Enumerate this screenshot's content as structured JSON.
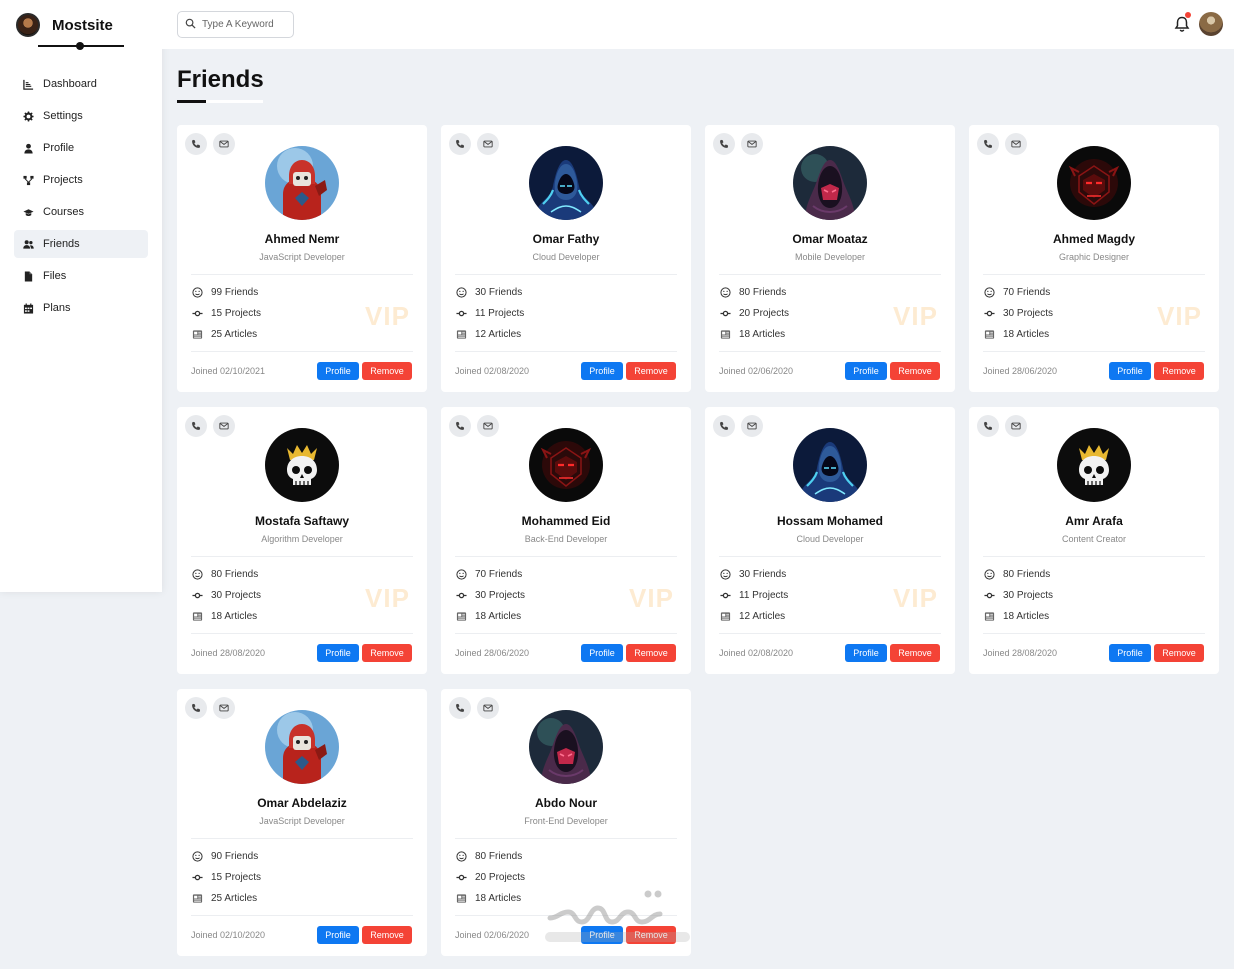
{
  "brand": {
    "name": "Mostsite"
  },
  "nav": [
    {
      "label": "Dashboard",
      "icon": "chart-icon",
      "active": false
    },
    {
      "label": "Settings",
      "icon": "gear-icon",
      "active": false
    },
    {
      "label": "Profile",
      "icon": "user-icon",
      "active": false
    },
    {
      "label": "Projects",
      "icon": "diagram-icon",
      "active": false
    },
    {
      "label": "Courses",
      "icon": "graduation-cap-icon",
      "active": false
    },
    {
      "label": "Friends",
      "icon": "users-icon",
      "active": true
    },
    {
      "label": "Files",
      "icon": "file-icon",
      "active": false
    },
    {
      "label": "Plans",
      "icon": "calendar-icon",
      "active": false
    }
  ],
  "search": {
    "placeholder": "Type A Keyword",
    "value": ""
  },
  "page": {
    "title": "Friends"
  },
  "buttons": {
    "profile": "Profile",
    "remove": "Remove"
  },
  "vip_label": "VIP",
  "friends": [
    {
      "name": "Ahmed Nemr",
      "role": "JavaScript Developer",
      "friends": "99 Friends",
      "projects": "15 Projects",
      "articles": "25 Articles",
      "joined": "Joined 02/10/2021",
      "vip": true,
      "avatar": "red-knight"
    },
    {
      "name": "Omar Fathy",
      "role": "Cloud Developer",
      "friends": "30 Friends",
      "projects": "11 Projects",
      "articles": "12 Articles",
      "joined": "Joined 02/08/2020",
      "vip": false,
      "avatar": "blue-hood"
    },
    {
      "name": "Omar Moataz",
      "role": "Mobile Developer",
      "friends": "80 Friends",
      "projects": "20 Projects",
      "articles": "18 Articles",
      "joined": "Joined 02/06/2020",
      "vip": true,
      "avatar": "pink-hood"
    },
    {
      "name": "Ahmed Magdy",
      "role": "Graphic Designer",
      "friends": "70 Friends",
      "projects": "30 Projects",
      "articles": "18 Articles",
      "joined": "Joined 28/06/2020",
      "vip": true,
      "avatar": "red-robot"
    },
    {
      "name": "Mostafa Saftawy",
      "role": "Algorithm Developer",
      "friends": "80 Friends",
      "projects": "30 Projects",
      "articles": "18 Articles",
      "joined": "Joined 28/08/2020",
      "vip": true,
      "avatar": "skull-crown"
    },
    {
      "name": "Mohammed Eid",
      "role": "Back-End Developer",
      "friends": "70 Friends",
      "projects": "30 Projects",
      "articles": "18 Articles",
      "joined": "Joined 28/06/2020",
      "vip": true,
      "avatar": "red-robot"
    },
    {
      "name": "Hossam Mohamed",
      "role": "Cloud Developer",
      "friends": "30 Friends",
      "projects": "11 Projects",
      "articles": "12 Articles",
      "joined": "Joined 02/08/2020",
      "vip": true,
      "avatar": "blue-hood"
    },
    {
      "name": "Amr Arafa",
      "role": "Content Creator",
      "friends": "80 Friends",
      "projects": "30 Projects",
      "articles": "18 Articles",
      "joined": "Joined 28/08/2020",
      "vip": false,
      "avatar": "skull-crown"
    },
    {
      "name": "Omar Abdelaziz",
      "role": "JavaScript Developer",
      "friends": "90 Friends",
      "projects": "15 Projects",
      "articles": "25 Articles",
      "joined": "Joined 02/10/2020",
      "vip": false,
      "avatar": "red-knight"
    },
    {
      "name": "Abdo Nour",
      "role": "Front-End Developer",
      "friends": "80 Friends",
      "projects": "20 Projects",
      "articles": "18 Articles",
      "joined": "Joined 02/06/2020",
      "vip": false,
      "avatar": "pink-hood"
    }
  ],
  "colors": {
    "primary": "#0e78f2",
    "danger": "#f44336",
    "vip": "#fdebd2",
    "background": "#eef1f5"
  }
}
